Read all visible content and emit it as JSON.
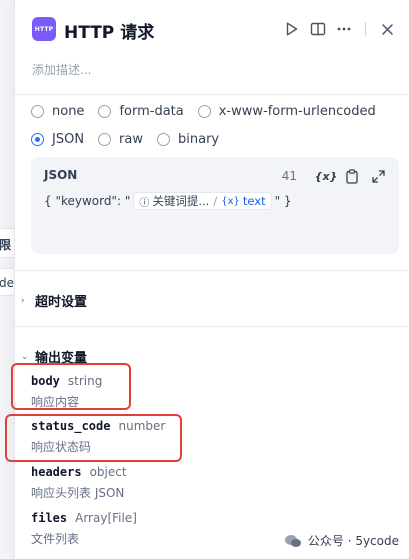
{
  "background": {
    "fragment_1": "限",
    "fragment_2": "de"
  },
  "header": {
    "app_icon_text": "HTTP",
    "title": "HTTP 请求",
    "description_placeholder": "添加描述..."
  },
  "body_type": {
    "options": [
      "none",
      "form-data",
      "x-www-form-urlencoded",
      "JSON",
      "raw",
      "binary"
    ],
    "selected": "JSON"
  },
  "json_editor": {
    "label": "JSON",
    "char_count": "41",
    "var_button": "{x}",
    "prefix": "{ \"keyword\": \"",
    "chip_node": "关键词提...",
    "chip_var_icon": "{x}",
    "chip_var": "text",
    "suffix": "\" }"
  },
  "sections": {
    "timeout": "超时设置",
    "output_vars": "输出变量"
  },
  "output_vars": [
    {
      "name": "body",
      "type": "string",
      "desc": "响应内容"
    },
    {
      "name": "status_code",
      "type": "number",
      "desc": "响应状态码"
    },
    {
      "name": "headers",
      "type": "object",
      "desc": "响应头列表 JSON"
    },
    {
      "name": "files",
      "type": "Array[File]",
      "desc": "文件列表"
    }
  ],
  "watermark": {
    "text": "公众号 · 5ycode"
  },
  "colors": {
    "accent": "#2970ff",
    "app_icon": "#7a5af8",
    "highlight": "#e0403a"
  }
}
